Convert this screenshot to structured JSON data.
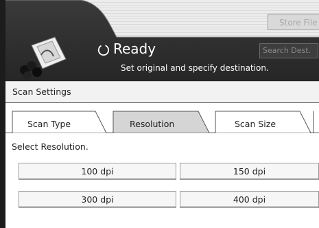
{
  "header": {
    "store_file_label": "Store File",
    "search_dest_label": "Search Dest.",
    "status": "Ready",
    "message": "Set original and specify destination."
  },
  "section": {
    "title": "Scan Settings"
  },
  "tabs": [
    {
      "label": "Scan Type",
      "selected": false
    },
    {
      "label": "Resolution",
      "selected": true
    },
    {
      "label": "Scan Size",
      "selected": false
    }
  ],
  "panel": {
    "prompt": "Select Resolution.",
    "options": [
      {
        "label": "100 dpi"
      },
      {
        "label": "150 dpi"
      },
      {
        "label": "300 dpi"
      },
      {
        "label": "400 dpi"
      }
    ]
  },
  "colors": {
    "header_dark": "#2e2e2e",
    "header_light": "#e6e6e6",
    "selected_tab": "#d5d5d5"
  }
}
